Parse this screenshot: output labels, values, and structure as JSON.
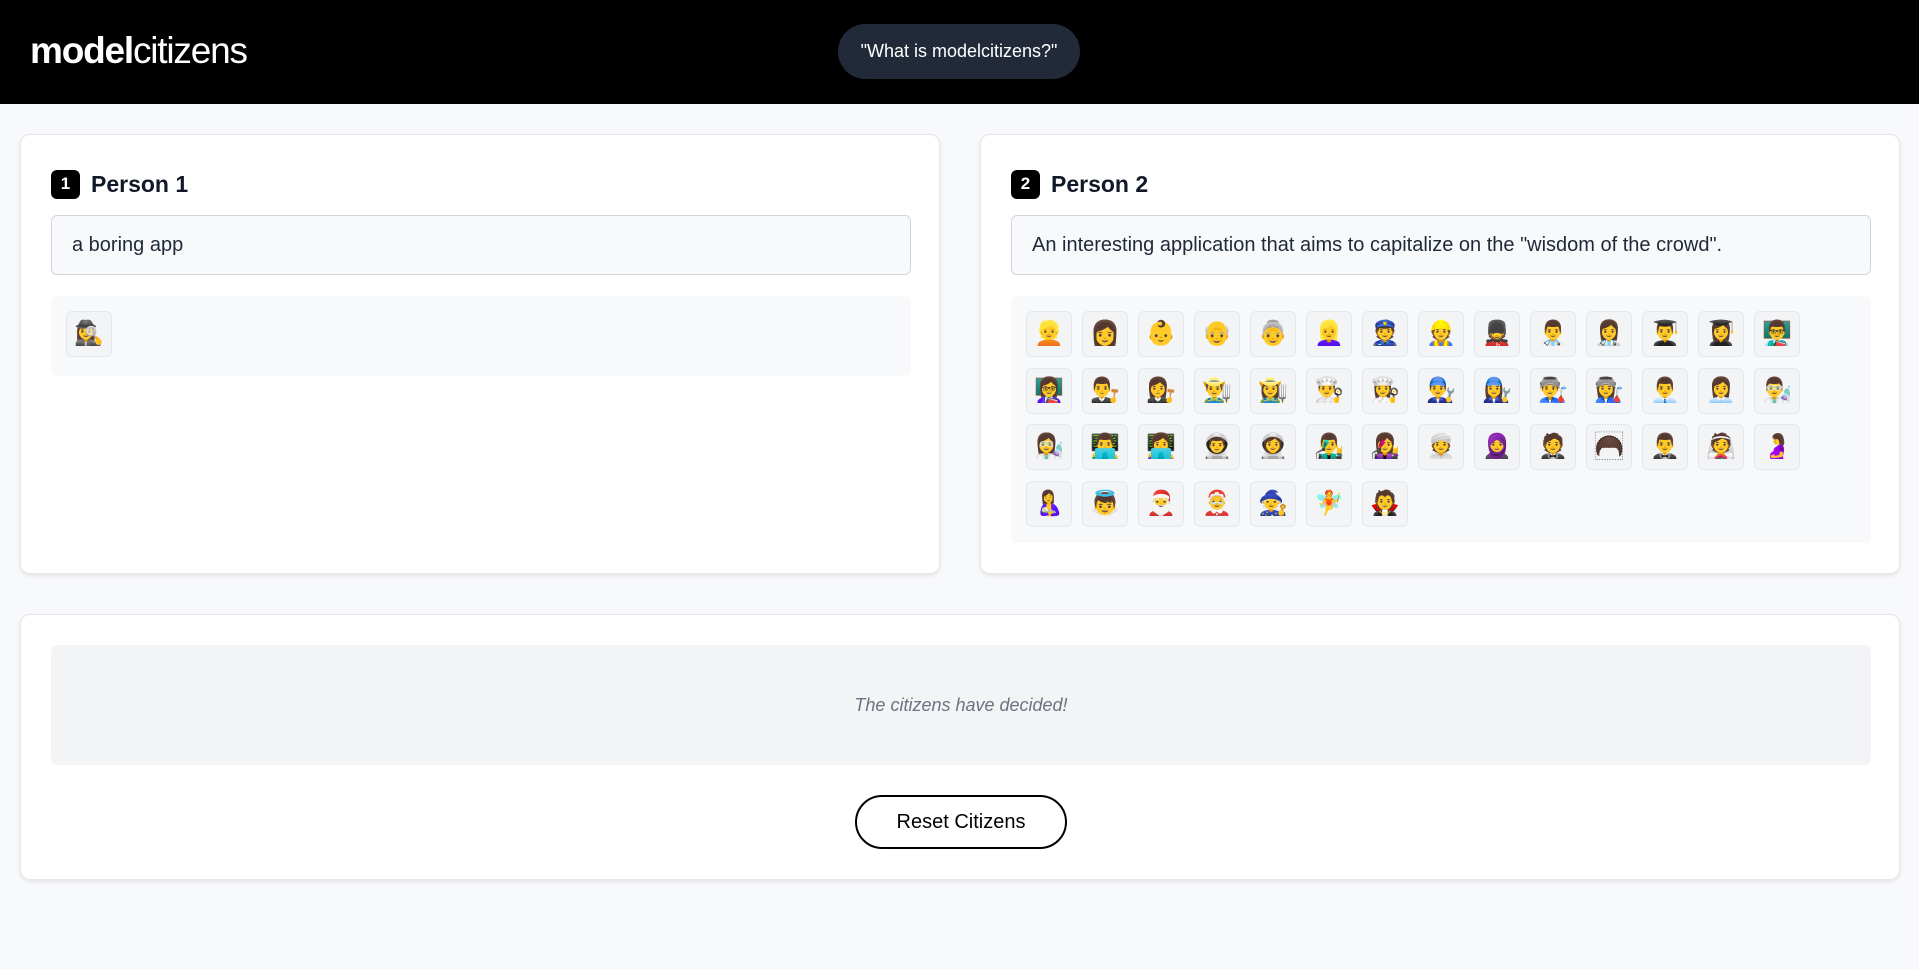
{
  "header": {
    "logo_bold": "model",
    "logo_light": "citizens",
    "about_button": "\"What is modelcitizens?\""
  },
  "person1": {
    "number": "1",
    "title": "Person 1",
    "input_value": "a boring app",
    "citizens": [
      "🕵️‍♀️"
    ]
  },
  "person2": {
    "number": "2",
    "title": "Person 2",
    "input_value": "An interesting application that aims to capitalize on the \"wisdom of the crowd\".",
    "citizens": [
      "👱",
      "👩",
      "👶",
      "👴",
      "👵",
      "👱‍♀️",
      "👮",
      "👷",
      "💂",
      "👨‍⚕️",
      "👩‍⚕️",
      "👨‍🎓",
      "👩‍🎓",
      "👨‍🏫",
      "👩‍🏫",
      "👨‍⚖️",
      "👩‍⚖️",
      "👨‍🌾",
      "👩‍🌾",
      "👨‍🍳",
      "👩‍🍳",
      "👨‍🔧",
      "👩‍🔧",
      "👨‍🏭",
      "👩‍🏭",
      "👨‍💼",
      "👩‍💼",
      "👨‍🔬",
      "👩‍🔬",
      "👨‍💻",
      "👩‍💻",
      "👨‍🚀",
      "👩‍🚀",
      "👨‍🎤",
      "👩‍🎤",
      "👳",
      "🧕",
      "🤵",
      "🦱",
      "🤵‍♂️",
      "👰",
      "🤰",
      "🤱",
      "👼",
      "🎅",
      "🤶",
      "🧙",
      "🧚",
      "🧛"
    ]
  },
  "result": {
    "message": "The citizens have decided!",
    "reset_button": "Reset Citizens"
  }
}
